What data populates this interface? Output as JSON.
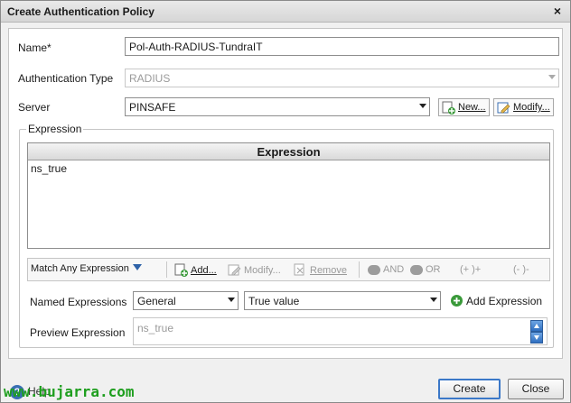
{
  "window": {
    "title": "Create Authentication Policy",
    "close_glyph": "×"
  },
  "form": {
    "name_label": "Name*",
    "name_value": "Pol-Auth-RADIUS-TundraIT",
    "auth_type_label": "Authentication Type",
    "auth_type_value": "RADIUS",
    "server_label": "Server",
    "server_value": "PINSAFE",
    "new_label": "New...",
    "modify_label": "Modify..."
  },
  "expression": {
    "legend": "Expression",
    "grid_header": "Expression",
    "rows": [
      "ns_true"
    ],
    "toolbar": {
      "match_label": "Match Any Expression",
      "add_label": "Add...",
      "modify_label": "Modify...",
      "remove_label": "Remove",
      "and_label": "AND",
      "or_label": "OR",
      "paren_open": "(+  )+",
      "paren_close": "(-  )-"
    },
    "named_expressions_label": "Named Expressions",
    "named_category": "General",
    "named_value": "True value",
    "add_expression_label": "Add Expression",
    "preview_label": "Preview Expression",
    "preview_value": "ns_true"
  },
  "footer": {
    "help_label": "Help",
    "create_label": "Create",
    "close_label": "Close",
    "watermark": "www.bujarra.com"
  },
  "colors": {
    "accent": "#3b78c8",
    "watermark": "#1e9e1e"
  }
}
